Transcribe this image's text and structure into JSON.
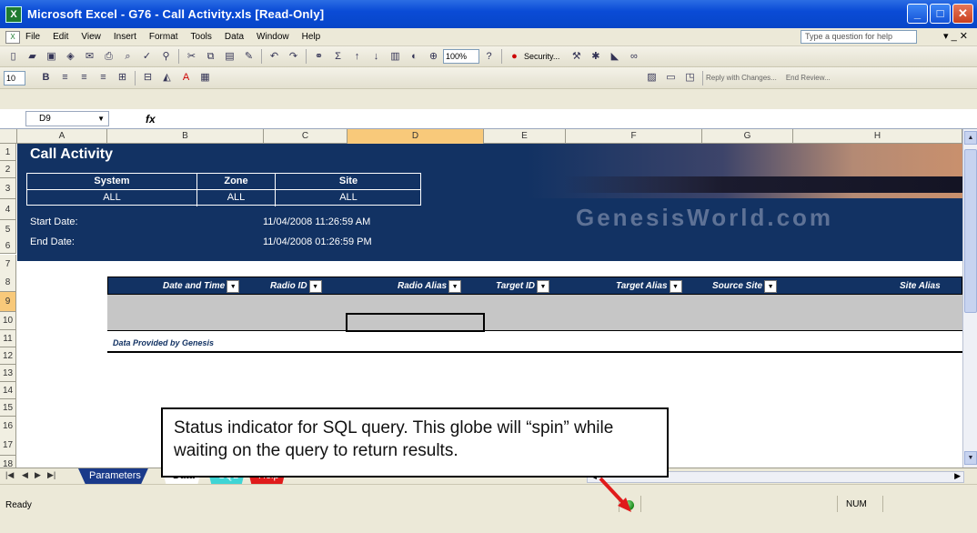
{
  "window": {
    "title": "Microsoft Excel - G76 - Call Activity.xls  [Read-Only]",
    "app_icon": "excel-icon",
    "buttons": [
      "minimize",
      "maximize",
      "close"
    ]
  },
  "menubar": {
    "items": [
      "File",
      "Edit",
      "View",
      "Insert",
      "Format",
      "Tools",
      "Data",
      "Window",
      "Help"
    ],
    "help_placeholder": "Type a question for help",
    "doc_controls": "▾ _ ✕"
  },
  "toolbar": {
    "zoom": "100%",
    "security_label": "Security...",
    "font_size": "10",
    "reply_label": "Reply with Changes...",
    "end_review_label": "End Review..."
  },
  "formula_bar": {
    "name_box": "D9",
    "fx": "fx"
  },
  "columns": [
    "A",
    "B",
    "C",
    "D",
    "E",
    "F",
    "G",
    "H"
  ],
  "rows": [
    "1",
    "2",
    "3",
    "4",
    "5",
    "6",
    "7",
    "8",
    "9",
    "10",
    "11",
    "12",
    "13",
    "14",
    "15",
    "16",
    "17",
    "18"
  ],
  "selected_cell": {
    "column": "D",
    "row": "9"
  },
  "banner": {
    "title": "Call Activity",
    "params": {
      "headers": [
        "System",
        "Zone",
        "Site"
      ],
      "values": [
        "ALL",
        "ALL",
        "ALL"
      ]
    },
    "start_label": "Start Date:",
    "start_value": "11/04/2008  11:26:59 AM",
    "end_label": "End Date:",
    "end_value": "11/04/2008  01:26:59 PM",
    "watermark": "GenesisWorld.com"
  },
  "table": {
    "headers": [
      "Date and Time",
      "Radio ID",
      "Radio Alias",
      "Target ID",
      "Target Alias",
      "Source Site",
      "Site Alias"
    ],
    "footer": "Data Provided by Genesis"
  },
  "callout": {
    "text": "Status indicator for SQL query.  This globe will “spin” while waiting on the query to return results."
  },
  "sheet_tabs": [
    {
      "label": "Parameters",
      "color": "#1a3a8a",
      "text_color": "#ffffff"
    },
    {
      "label": "Data",
      "color": "#ffffff",
      "text_color": "#000000"
    },
    {
      "label": "SQL",
      "color": "#3fd5d5",
      "text_color": "#ffffff"
    },
    {
      "label": "Help",
      "color": "#e01b1b",
      "text_color": "#ffffff"
    }
  ],
  "status": {
    "ready": "Ready",
    "num": "NUM",
    "globe": "globe-icon"
  },
  "colors": {
    "banner": "#123263",
    "title_bar": "#0a4bd6",
    "selected_header": "#f8c97a",
    "arrow": "#e01b1b"
  }
}
